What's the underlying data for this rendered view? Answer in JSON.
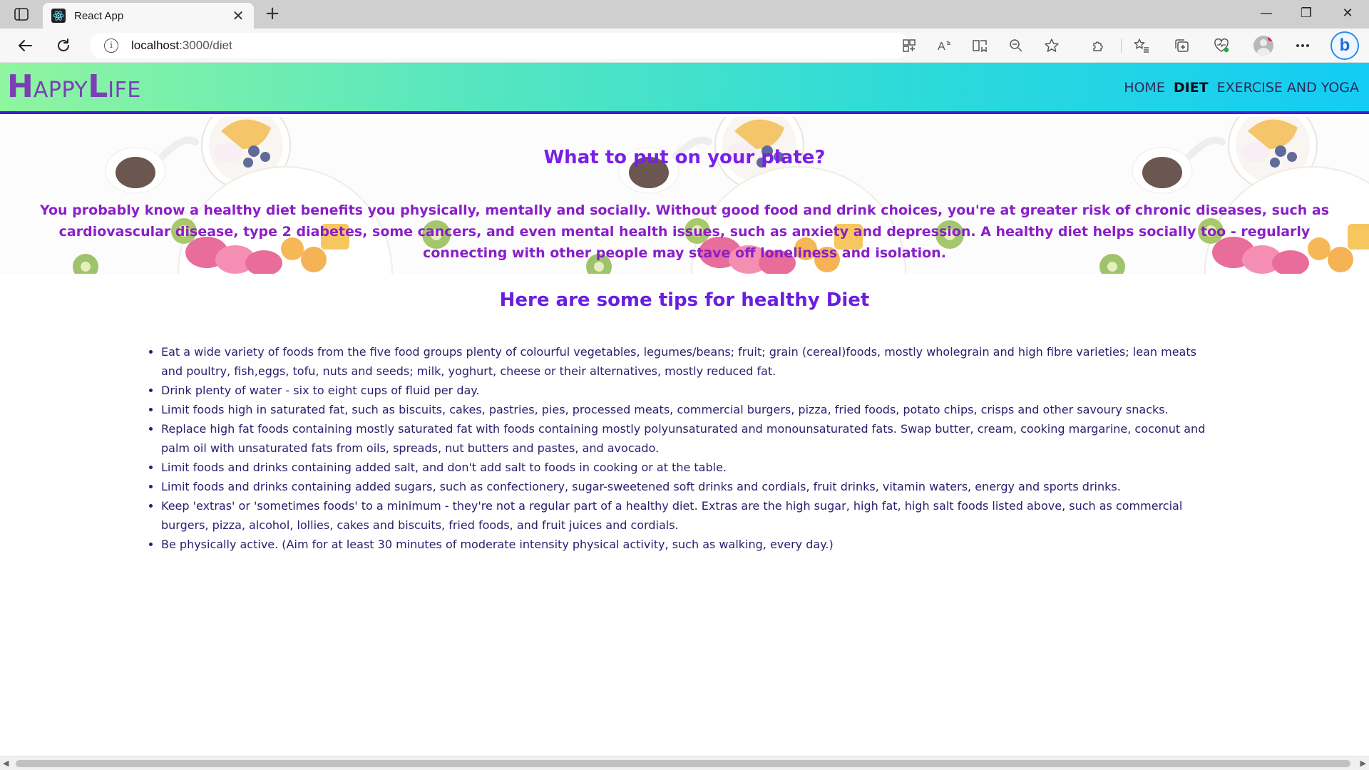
{
  "browser": {
    "tab_title": "React App",
    "tab_close": "✕",
    "new_tab": "+",
    "url_host": "localhost",
    "url_path": ":3000/diet",
    "window_minimize": "—",
    "window_restore": "❐",
    "window_close": "✕",
    "bing_label": "b"
  },
  "site": {
    "logo": {
      "first_big": "H",
      "first_rest": "APPY",
      "second_big": "L",
      "second_rest": "IFE"
    },
    "nav": [
      {
        "label": "HOME",
        "active": false
      },
      {
        "label": "DIET",
        "active": true
      },
      {
        "label": "EXERCISE AND YOGA",
        "active": false
      }
    ]
  },
  "hero": {
    "title": "What to put on your plate?",
    "text": "You probably know a healthy diet benefits you physically, mentally and socially. Without good food and drink choices, you're at greater risk of chronic diseases, such as cardiovascular disease, type 2 diabetes, some cancers, and even mental health issues, such as anxiety and depression. A healthy diet helps socially too - regularly connecting with other people may stave off loneliness and isolation."
  },
  "tips": {
    "title": "Here are some tips for healthy Diet",
    "items": [
      "Eat a wide variety of foods from the five food groups plenty of colourful vegetables, legumes/beans; fruit; grain (cereal)foods, mostly wholegrain and high fibre varieties; lean meats and poultry, fish,eggs, tofu, nuts and seeds; milk, yoghurt, cheese or their alternatives, mostly reduced fat.",
      "Drink plenty of water - six to eight cups of fluid per day.",
      "Limit foods high in saturated fat, such as biscuits, cakes, pastries, pies, processed meats, commercial burgers, pizza, fried foods, potato chips, crisps and other savoury snacks.",
      "Replace high fat foods containing mostly saturated fat with foods containing mostly polyunsaturated and monounsaturated fats. Swap butter, cream, cooking margarine, coconut and palm oil with unsaturated fats from oils, spreads, nut butters and pastes, and avocado.",
      "Limit foods and drinks containing added salt, and don't add salt to foods in cooking or at the table.",
      "Limit foods and drinks containing added sugars, such as confectionery, sugar-sweetened soft drinks and cordials, fruit drinks, vitamin waters, energy and sports drinks.",
      "Keep 'extras' or 'sometimes foods' to a minimum - they're not a regular part of a healthy diet. Extras are the high sugar, high fat, high salt foods listed above, such as commercial burgers, pizza, alcohol, lollies, cakes and biscuits, fried foods, and fruit juices and cordials.",
      "Be physically active. (Aim for at least 30 minutes of moderate intensity physical activity, such as walking, every day.)"
    ]
  },
  "colors": {
    "nav_gradient_start": "#8ff59f",
    "nav_gradient_end": "#13ccf5",
    "nav_border": "#3f1fd1",
    "logo": "#7a3fb7",
    "heading": "#7a1fe8",
    "body_text": "#2b1c6e"
  },
  "icons": [
    "tab-actions-icon",
    "react-favicon-icon",
    "back-arrow-icon",
    "refresh-icon",
    "site-info-icon",
    "apps-icon",
    "read-aloud-icon",
    "immersive-reader-icon",
    "zoom-out-icon",
    "favorite-star-icon",
    "extensions-icon",
    "favorites-icon",
    "collections-icon",
    "browser-essentials-icon",
    "profile-icon",
    "more-options-icon",
    "bing-chat-icon"
  ]
}
